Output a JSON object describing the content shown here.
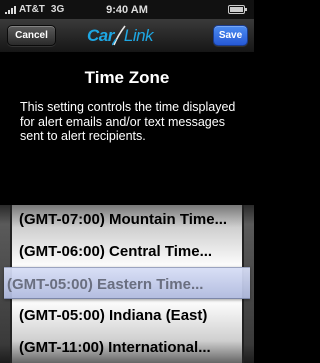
{
  "status_bar": {
    "carrier": "AT&T",
    "network": "3G",
    "time": "9:40 AM"
  },
  "nav": {
    "cancel_label": "Cancel",
    "save_label": "Save",
    "logo_part1": "Car",
    "logo_part2": "Link"
  },
  "main": {
    "title": "Time Zone",
    "description": "This setting controls the time displayed for alert emails and/or text messages sent to alert recipients."
  },
  "picker": {
    "options": [
      "(GMT-07:00) Mountain Time...",
      "(GMT-06:00) Central Time...",
      "(GMT-05:00) Eastern Time...",
      "(GMT-05:00) Indiana (East)",
      "(GMT-11:00) International..."
    ],
    "selected_index": 2
  },
  "colors": {
    "save_button": "#2f67e0",
    "logo": "#1ea7e3",
    "selection_bar": "#c3cbe8"
  }
}
